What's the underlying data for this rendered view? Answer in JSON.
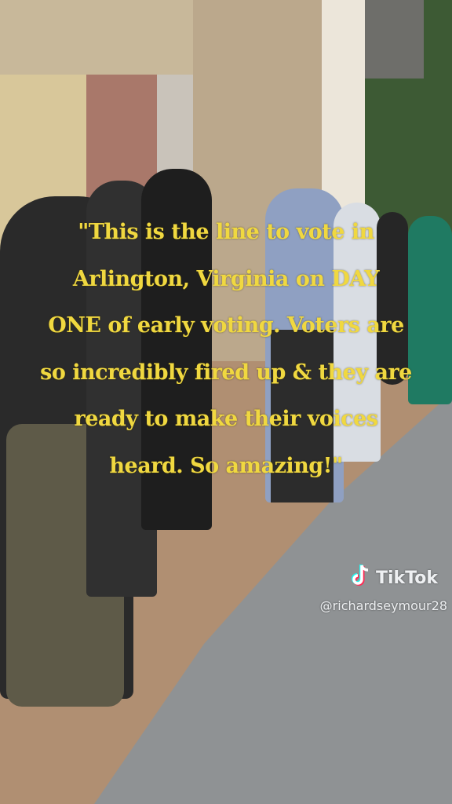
{
  "caption": {
    "lines": [
      "\"This is the line to vote in",
      "Arlington, Virginia on DAY",
      "ONE of early voting. Voters are",
      "so incredibly fired up & they are",
      "ready to make their voices",
      "heard.  So amazing!\""
    ],
    "color": "#f0d840"
  },
  "watermark": {
    "brand": "TikTok",
    "handle": "@richardseymour28",
    "icon": "tiktok-note-icon"
  }
}
